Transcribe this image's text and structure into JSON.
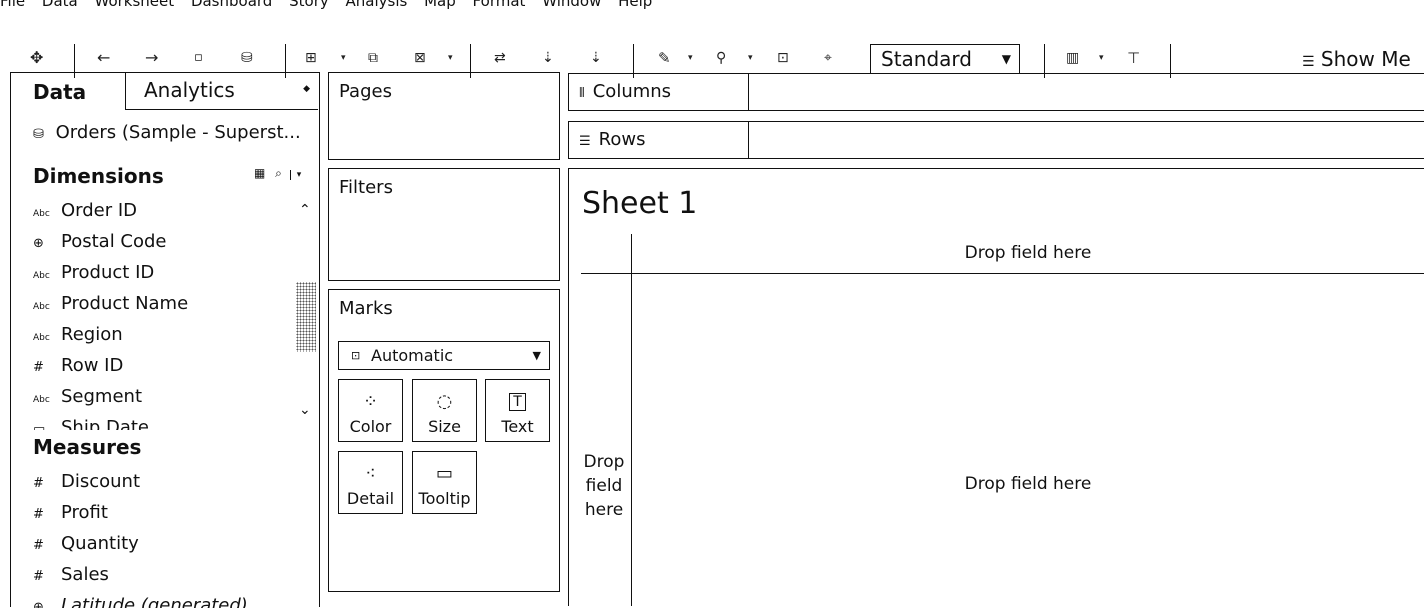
{
  "menu": [
    "File",
    "Data",
    "Worksheet",
    "Dashboard",
    "Story",
    "Analysis",
    "Map",
    "Format",
    "Window",
    "Help"
  ],
  "toolbar": {
    "view_size": "Standard",
    "show_me": "Show Me",
    "icons": [
      "tableau-logo-icon",
      "undo-icon",
      "redo-icon",
      "save-icon",
      "new-datasource-icon",
      "new-worksheet-icon",
      "duplicate-icon",
      "clear-sheet-icon",
      "swap-icon",
      "sort-ascending-icon",
      "sort-descending-icon",
      "highlight-icon",
      "group-icon",
      "label-icon",
      "fix-axes-icon",
      "fit-icon",
      "presentation-icon"
    ]
  },
  "data_pane": {
    "tab_data": "Data",
    "tab_analytics": "Analytics",
    "source": "Orders (Sample - Superst...",
    "dimensions_title": "Dimensions",
    "dimensions": [
      {
        "icon": "Abc",
        "label": "Order ID"
      },
      {
        "icon": "⊕",
        "label": "Postal Code"
      },
      {
        "icon": "Abc",
        "label": "Product ID"
      },
      {
        "icon": "Abc",
        "label": "Product Name"
      },
      {
        "icon": "Abc",
        "label": "Region"
      },
      {
        "icon": "#",
        "label": "Row ID"
      },
      {
        "icon": "Abc",
        "label": "Segment"
      },
      {
        "icon": "▭",
        "label": "Ship Date"
      }
    ],
    "measures_title": "Measures",
    "measures": [
      {
        "icon": "#",
        "label": "Discount"
      },
      {
        "icon": "#",
        "label": "Profit"
      },
      {
        "icon": "#",
        "label": "Quantity"
      },
      {
        "icon": "#",
        "label": "Sales"
      },
      {
        "icon": "⊕",
        "label": "Latitude (generated)"
      }
    ]
  },
  "cards": {
    "pages": "Pages",
    "filters": "Filters",
    "marks": "Marks",
    "mark_type": "Automatic",
    "mark_buttons": [
      "Color",
      "Size",
      "Text",
      "Detail",
      "Tooltip"
    ]
  },
  "shelves": {
    "columns": "Columns",
    "rows": "Rows"
  },
  "view": {
    "sheet_title": "Sheet 1",
    "drop_top": "Drop field here",
    "drop_center": "Drop field here",
    "drop_left": [
      "Drop",
      "field",
      "here"
    ]
  }
}
